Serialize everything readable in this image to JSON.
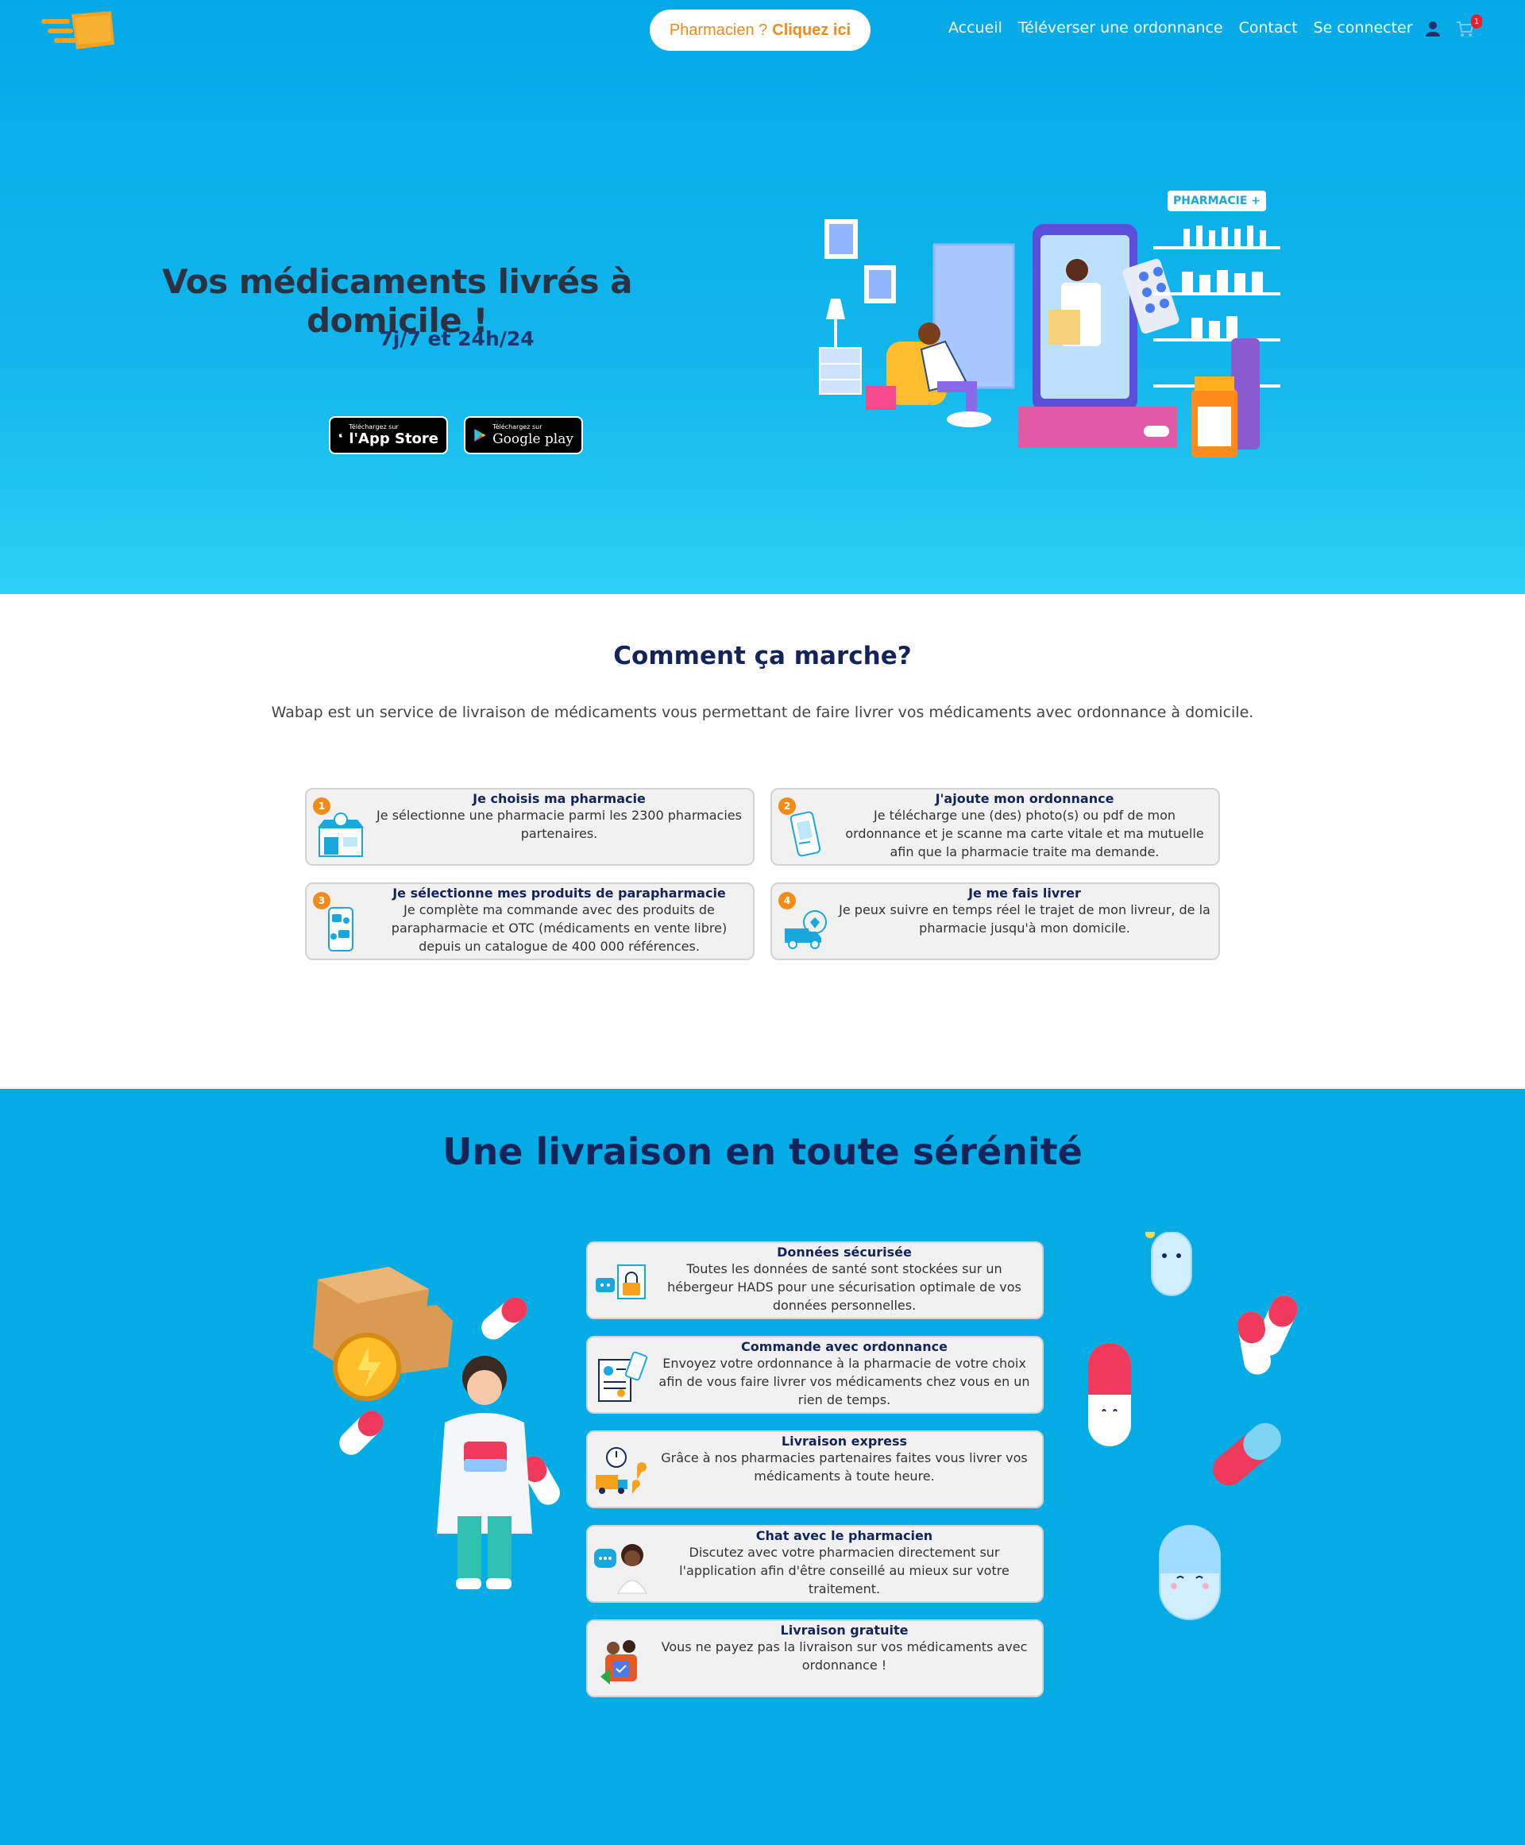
{
  "header": {
    "pharmacist_cta_prefix": "Pharmacien ?",
    "pharmacist_cta_link": "Cliquez ici",
    "nav": [
      "Accueil",
      "Téléverser une ordonnance",
      "Contact",
      "Se connecter"
    ],
    "cart_count": "1"
  },
  "hero": {
    "title": "Vos médicaments livrés à domicile !",
    "subtitle": "7j/7 et 24h/24",
    "appstore_small": "Téléchargez sur",
    "appstore_big": "l'App Store",
    "googleplay_small": "Téléchargez sur",
    "googleplay_big": "Google play",
    "pharmacie_tag": "PHARMACIE +"
  },
  "how": {
    "title": "Comment ça marche?",
    "description": "Wabap est un service de livraison de médicaments vous permettant de faire livrer vos médicaments avec ordonnance à domicile.",
    "steps": [
      {
        "num": "1",
        "title": "Je choisis ma pharmacie",
        "desc": "Je sélectionne une pharmacie parmi les 2300 pharmacies partenaires."
      },
      {
        "num": "2",
        "title": "J'ajoute mon ordonnance",
        "desc": "Je télécharge une (des) photo(s) ou pdf de mon ordonnance et je scanne ma carte vitale et ma mutuelle afin que la pharmacie traite ma demande."
      },
      {
        "num": "3",
        "title": "Je sélectionne mes produits de parapharmacie",
        "desc": "Je complète ma commande avec des produits de parapharmacie et OTC (médicaments en vente libre) depuis un catalogue de 400 000 références."
      },
      {
        "num": "4",
        "title": "Je me fais livrer",
        "desc": "Je peux suivre en temps réel le trajet de mon livreur, de la pharmacie jusqu'à mon domicile."
      }
    ]
  },
  "delivery": {
    "title": "Une livraison en toute sérénité",
    "features": [
      {
        "title": "Données sécurisée",
        "desc": "Toutes les données de santé sont stockées sur un hébergeur HADS pour une sécurisation optimale de vos données personnelles."
      },
      {
        "title": "Commande avec ordonnance",
        "desc": "Envoyez votre ordonnance à la pharmacie de votre choix afin de vous faire livrer vos médicaments chez vous en un rien de temps."
      },
      {
        "title": "Livraison express",
        "desc": "Grâce à nos pharmacies partenaires faites vous livrer vos médicaments à toute heure."
      },
      {
        "title": "Chat avec le pharmacien",
        "desc": "Discutez avec votre pharmacien directement sur l'application afin d'être conseillé au mieux sur votre traitement."
      },
      {
        "title": "Livraison gratuite",
        "desc": "Vous ne payez pas la livraison sur vos médicaments avec ordonnance !"
      }
    ]
  },
  "colors": {
    "hero_top": "#05a9e6",
    "hero_bottom": "#2bd1f4",
    "accent_orange": "#f28c18",
    "navy": "#14245a",
    "section_blue": "#03ace4"
  },
  "icons": [
    "logo",
    "user-icon",
    "cart-icon",
    "apple-icon",
    "google-play-icon",
    "pharmacy-store-icon",
    "phone-prescription-icon",
    "chat-products-icon",
    "delivery-truck-icon",
    "secure-data-icon",
    "prescription-order-icon",
    "express-delivery-icon",
    "pharmacist-chat-icon",
    "free-delivery-icon"
  ]
}
